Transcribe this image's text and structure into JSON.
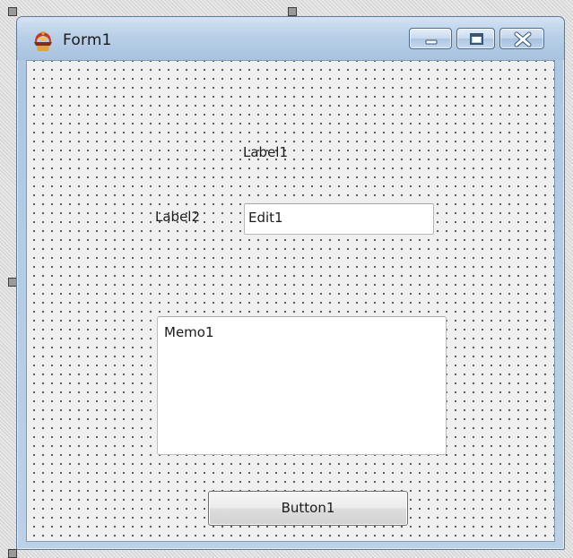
{
  "window": {
    "title": "Form1",
    "icon": "delphi-helmet-icon",
    "controls": [
      "minimize",
      "maximize",
      "close"
    ]
  },
  "form": {
    "label1": "Label1",
    "label2": "Label2",
    "edit1_value": "Edit1",
    "memo1_value": "Memo1",
    "button1_label": "Button1"
  },
  "colors": {
    "titlebar": "#b8cfe7",
    "close_button_glyph": "#c2423a",
    "client_background": "#f0f0f0"
  }
}
